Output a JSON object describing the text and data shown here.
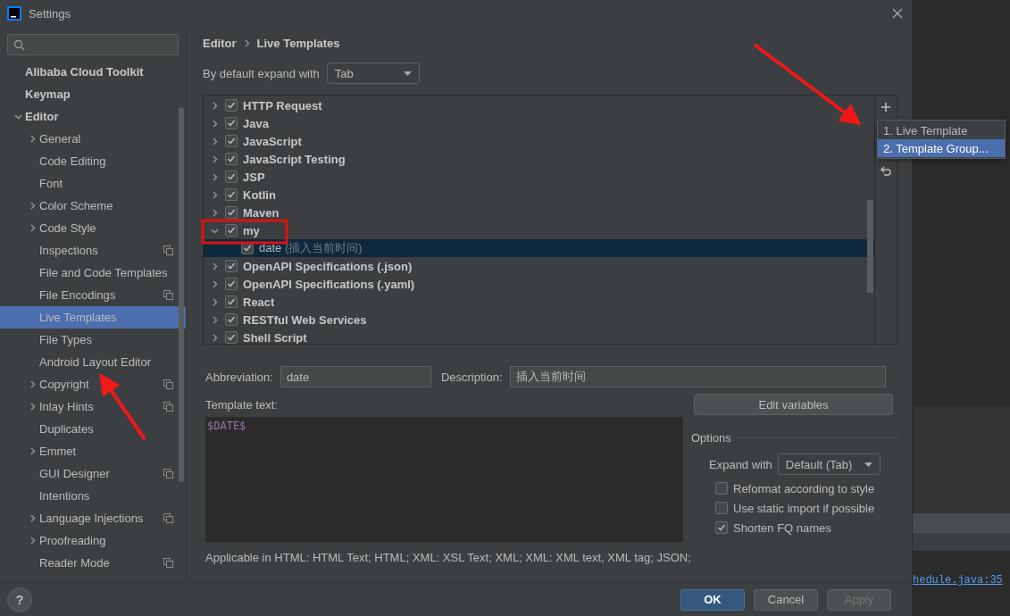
{
  "window": {
    "title": "Settings"
  },
  "sidebar": {
    "items": [
      {
        "label": "Alibaba Cloud Toolkit",
        "kind": "page",
        "selected": false,
        "project_icon": false
      },
      {
        "label": "Keymap",
        "kind": "page",
        "selected": false,
        "project_icon": false
      },
      {
        "label": "Editor",
        "kind": "group",
        "expanded": true,
        "selected": false,
        "project_icon": false,
        "children": [
          {
            "label": "General",
            "kind": "group",
            "expanded": false,
            "selected": false,
            "project_icon": false
          },
          {
            "label": "Code Editing",
            "kind": "page",
            "selected": false,
            "project_icon": false
          },
          {
            "label": "Font",
            "kind": "page",
            "selected": false,
            "project_icon": false
          },
          {
            "label": "Color Scheme",
            "kind": "group",
            "expanded": false,
            "selected": false,
            "project_icon": false
          },
          {
            "label": "Code Style",
            "kind": "group",
            "expanded": false,
            "selected": false,
            "project_icon": false
          },
          {
            "label": "Inspections",
            "kind": "page",
            "selected": false,
            "project_icon": true
          },
          {
            "label": "File and Code Templates",
            "kind": "page",
            "selected": false,
            "project_icon": false
          },
          {
            "label": "File Encodings",
            "kind": "page",
            "selected": false,
            "project_icon": true
          },
          {
            "label": "Live Templates",
            "kind": "page",
            "selected": true,
            "project_icon": false
          },
          {
            "label": "File Types",
            "kind": "page",
            "selected": false,
            "project_icon": false
          },
          {
            "label": "Android Layout Editor",
            "kind": "page",
            "selected": false,
            "project_icon": false
          },
          {
            "label": "Copyright",
            "kind": "group",
            "expanded": false,
            "selected": false,
            "project_icon": true
          },
          {
            "label": "Inlay Hints",
            "kind": "group",
            "expanded": false,
            "selected": false,
            "project_icon": true
          },
          {
            "label": "Duplicates",
            "kind": "page",
            "selected": false,
            "project_icon": false
          },
          {
            "label": "Emmet",
            "kind": "group",
            "expanded": false,
            "selected": false,
            "project_icon": false
          },
          {
            "label": "GUI Designer",
            "kind": "page",
            "selected": false,
            "project_icon": true
          },
          {
            "label": "Intentions",
            "kind": "page",
            "selected": false,
            "project_icon": false
          },
          {
            "label": "Language Injections",
            "kind": "group",
            "expanded": false,
            "selected": false,
            "project_icon": true
          },
          {
            "label": "Proofreading",
            "kind": "group",
            "expanded": false,
            "selected": false,
            "project_icon": false
          },
          {
            "label": "Reader Mode",
            "kind": "page",
            "selected": false,
            "project_icon": true
          }
        ]
      }
    ]
  },
  "breadcrumb": [
    "Editor",
    "Live Templates"
  ],
  "expand_default": {
    "label": "By default expand with",
    "value": "Tab"
  },
  "templates": [
    {
      "label": "HTTP Request",
      "checked": true,
      "expanded": false,
      "selected": false
    },
    {
      "label": "Java",
      "checked": true,
      "expanded": false,
      "selected": false
    },
    {
      "label": "JavaScript",
      "checked": true,
      "expanded": false,
      "selected": false
    },
    {
      "label": "JavaScript Testing",
      "checked": true,
      "expanded": false,
      "selected": false
    },
    {
      "label": "JSP",
      "checked": true,
      "expanded": false,
      "selected": false
    },
    {
      "label": "Kotlin",
      "checked": true,
      "expanded": false,
      "selected": false
    },
    {
      "label": "Maven",
      "checked": true,
      "expanded": false,
      "selected": false
    },
    {
      "label": "my",
      "checked": true,
      "expanded": true,
      "selected": false,
      "children": [
        {
          "label": "date",
          "description": "(插入当前时间)",
          "checked": true,
          "selected": true
        }
      ]
    },
    {
      "label": "OpenAPI Specifications (.json)",
      "checked": true,
      "expanded": false,
      "selected": false
    },
    {
      "label": "OpenAPI Specifications (.yaml)",
      "checked": true,
      "expanded": false,
      "selected": false
    },
    {
      "label": "React",
      "checked": true,
      "expanded": false,
      "selected": false
    },
    {
      "label": "RESTful Web Services",
      "checked": true,
      "expanded": false,
      "selected": false
    },
    {
      "label": "Shell Script",
      "checked": true,
      "expanded": false,
      "selected": false
    }
  ],
  "add_menu": {
    "items": [
      {
        "label": "1. Live Template",
        "selected": false
      },
      {
        "label": "2. Template Group...",
        "selected": true
      }
    ]
  },
  "abbreviation": {
    "label": "Abbreviation:",
    "value": "date"
  },
  "description": {
    "label": "Description:",
    "value": "插入当前时间"
  },
  "template_text": {
    "label": "Template text:",
    "value": "$DATE$"
  },
  "edit_variables": "Edit variables",
  "options": {
    "title": "Options",
    "expand_with": {
      "label": "Expand with",
      "value": "Default (Tab)"
    },
    "checkboxes": [
      {
        "label": "Reformat according to style",
        "checked": false
      },
      {
        "label": "Use static import if possible",
        "checked": false
      },
      {
        "label": "Shorten FQ names",
        "checked": true
      }
    ]
  },
  "applicable": "Applicable in HTML: HTML Text; HTML; XML: XSL Text; XML; XML: XML text, XML tag; JSON;",
  "help": "?",
  "buttons": [
    {
      "label": "OK",
      "kind": "primary",
      "disabled": false
    },
    {
      "label": "Cancel",
      "kind": "default",
      "disabled": false
    },
    {
      "label": "Apply",
      "kind": "default",
      "disabled": true
    }
  ],
  "background_editor": {
    "link": "hedule.java:35"
  }
}
